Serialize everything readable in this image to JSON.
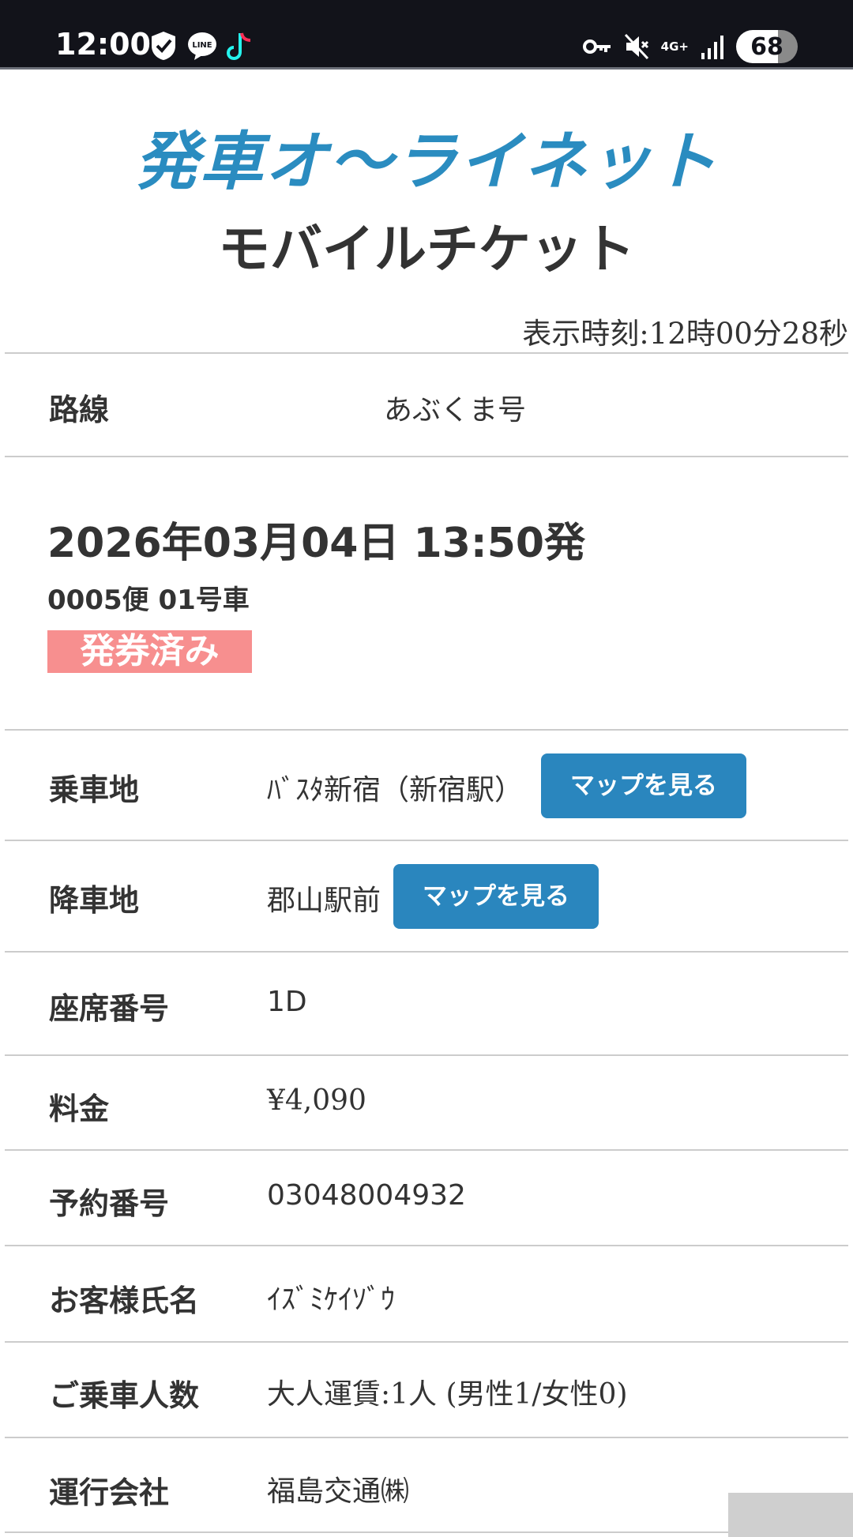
{
  "status_bar": {
    "time": "12:00",
    "left_icons": [
      "shield-check-icon",
      "line-app-icon",
      "tiktok-icon"
    ],
    "right_icons": [
      "key-icon",
      "mute-icon",
      "4g-icon",
      "signal-icon"
    ],
    "network": "4G+",
    "battery": "68"
  },
  "header": {
    "brand": "発車オ～ライネット",
    "subtitle": "モバイルチケット",
    "display_time": "表示時刻:12時00分28秒"
  },
  "route": {
    "label": "路線",
    "value": "あぶくま号"
  },
  "departure": {
    "datetime": "2026年03月04日 13:50発",
    "bin": "0005便 01号車",
    "status_badge": "発券済み"
  },
  "boarding": {
    "label": "乗車地",
    "value": "ﾊﾞｽﾀ新宿（新宿駅）",
    "button": "マップを見る"
  },
  "alighting": {
    "label": "降車地",
    "value": "郡山駅前",
    "button": "マップを見る"
  },
  "seat": {
    "label": "座席番号",
    "value": "1D"
  },
  "fare": {
    "label": "料金",
    "value": "¥4,090"
  },
  "reservation": {
    "label": "予約番号",
    "value": "03048004932"
  },
  "customer": {
    "label": "お客様氏名",
    "value": "ｲｽﾞﾐｹｲｿﾞｳ"
  },
  "passengers": {
    "label": "ご乗車人数",
    "value": "大人運賃:1人 (男性1/女性0)"
  },
  "operator": {
    "label": "運行会社",
    "value": "福島交通㈱"
  }
}
